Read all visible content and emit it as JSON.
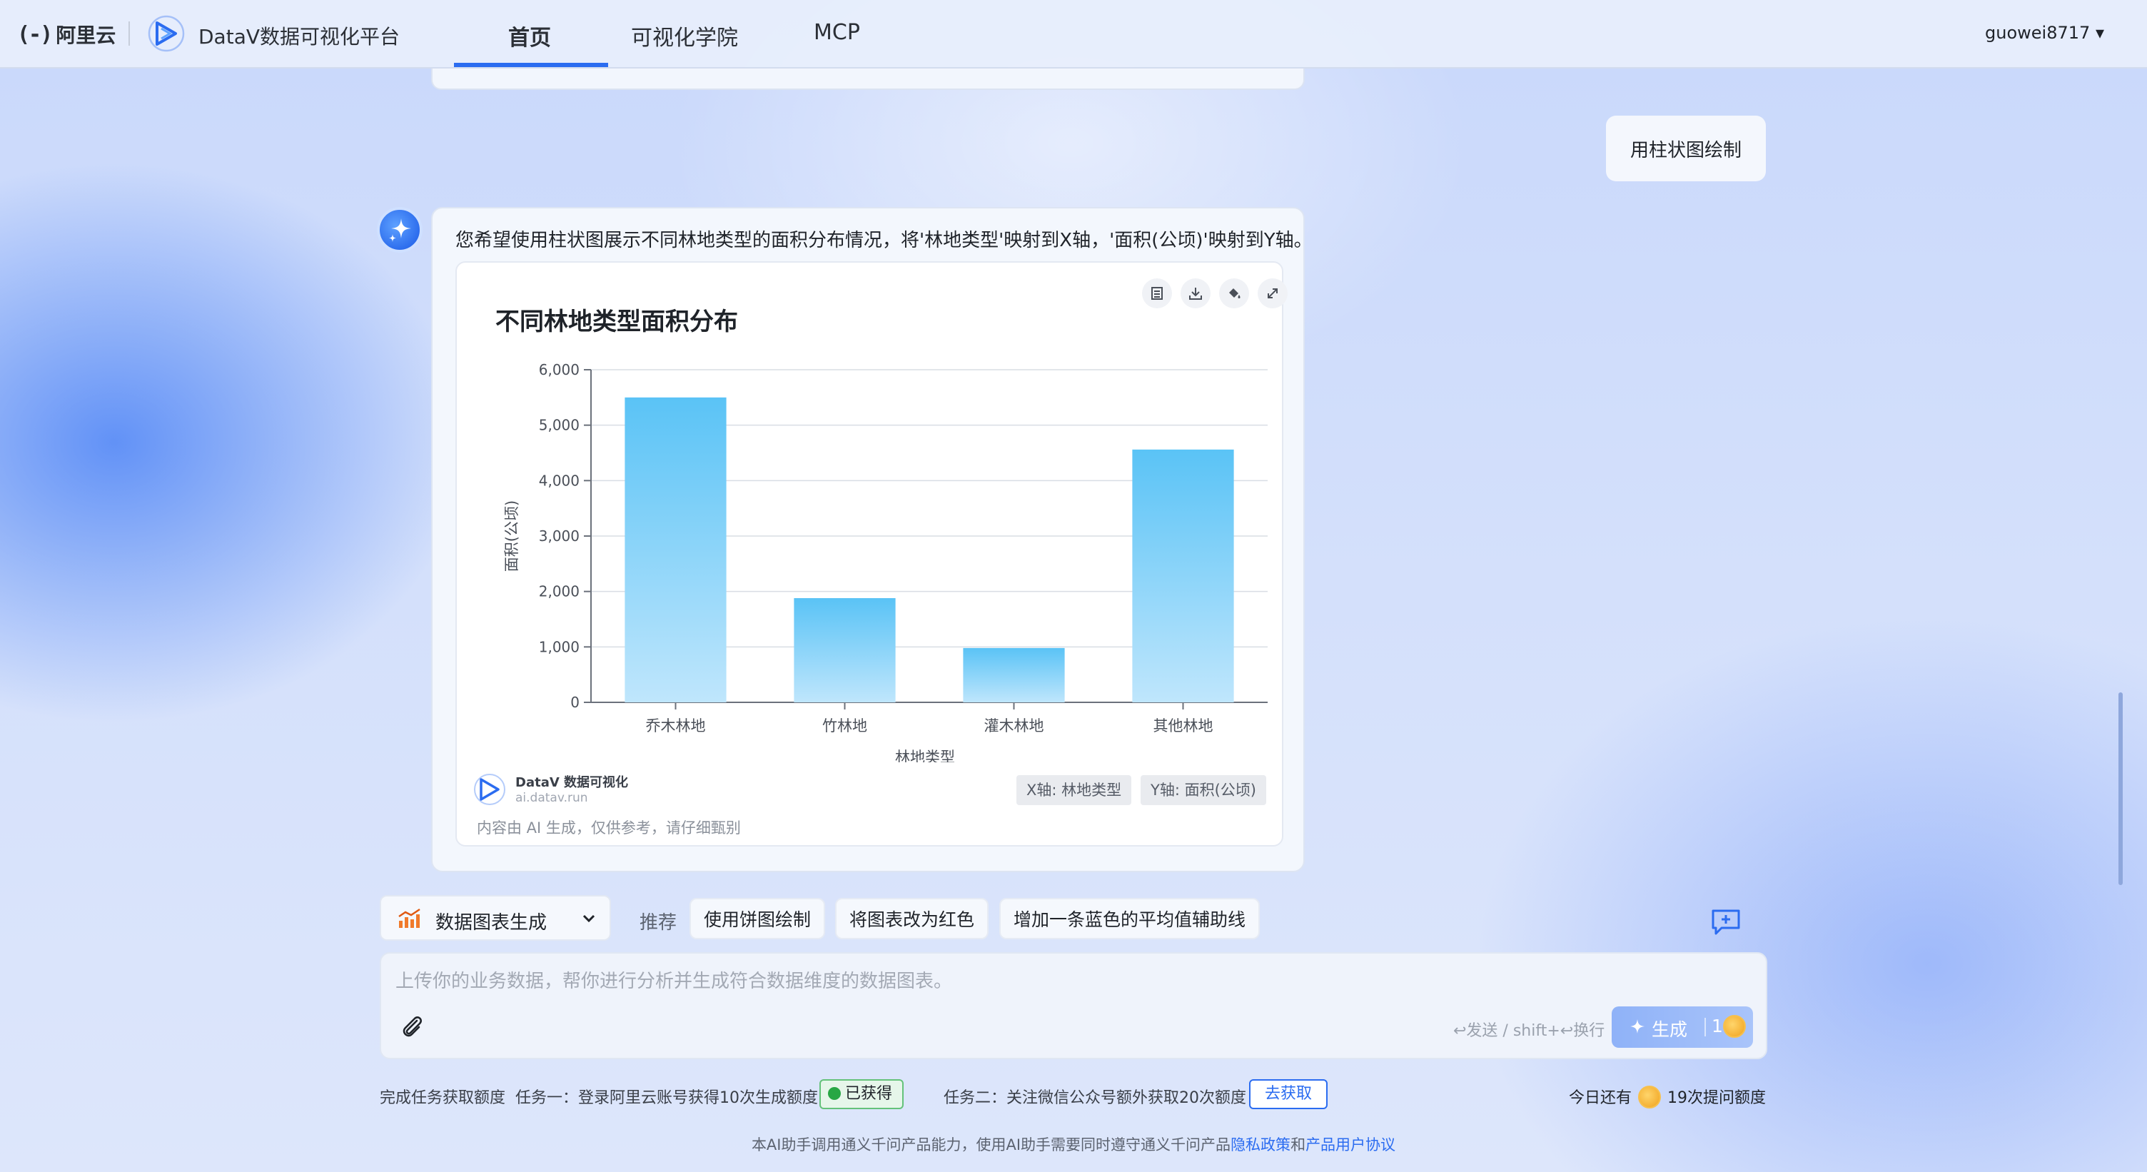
{
  "header": {
    "aliyun_mark": "(-)",
    "aliyun_text": "阿里云",
    "platform_title": "DataV数据可视化平台",
    "nav": [
      "首页",
      "可视化学院",
      "MCP"
    ],
    "user_name": "guowei8717",
    "user_caret": "▾"
  },
  "conversation": {
    "user_message": "用柱状图绘制",
    "ai_message": "您希望使用柱状图展示不同林地类型的面积分布情况，将'林地类型'映射到X轴，'面积(公顷)'映射到Y轴。"
  },
  "chart_card": {
    "tools": [
      "table-icon",
      "download-icon",
      "paint-icon",
      "expand-icon"
    ],
    "brand": "DataV 数据可视化",
    "brand_url": "ai.datav.run",
    "note": "内容由 AI 生成，仅供参考，请仔细甄别",
    "x_tag": "X轴: 林地类型",
    "y_tag": "Y轴: 面积(公顷)"
  },
  "chart_data": {
    "type": "bar",
    "title": "不同林地类型面积分布",
    "xlabel": "林地类型",
    "ylabel": "面积(公顷)",
    "categories": [
      "乔木林地",
      "竹林地",
      "灌木林地",
      "其他林地"
    ],
    "values": [
      5500,
      1880,
      980,
      4560
    ],
    "ylim": [
      0,
      6000
    ],
    "yticks": [
      0,
      1000,
      2000,
      3000,
      4000,
      5000,
      6000
    ],
    "ytick_labels": [
      "0",
      "1,000",
      "2,000",
      "3,000",
      "4,000",
      "5,000",
      "6,000"
    ],
    "grid": true,
    "bar_color_top": "#5ac3f6",
    "bar_color_bottom": "#bfe6fc"
  },
  "toolbar": {
    "mode_label": "数据图表生成",
    "recommend_label": "推荐",
    "chips": [
      "使用饼图绘制",
      "将图表改为红色",
      "增加一条蓝色的平均值辅助线"
    ]
  },
  "input": {
    "placeholder": "上传你的业务数据，帮你进行分析并生成符合数据维度的数据图表。",
    "send_hint": "↩发送 / shift+↩换行",
    "generate_label": "生成",
    "generate_cost": "1"
  },
  "tasks": {
    "intro": "完成任务获取额度",
    "task1": "任务一：登录阿里云账号获得10次生成额度",
    "task1_status": "已获得",
    "task2": "任务二：关注微信公众号额外获取20次额度",
    "task2_button": "去获取",
    "quota_prefix": "今日还有",
    "quota_suffix": "19次提问额度"
  },
  "footer": {
    "text": "本AI助手调用通义千问产品能力，使用AI助手需要同时遵守通义千问产品",
    "privacy_link": "隐私政策",
    "and": "和",
    "agreement_link": "产品用户协议"
  },
  "colors": {
    "accent": "#2b6cf0",
    "success": "#28a745"
  }
}
